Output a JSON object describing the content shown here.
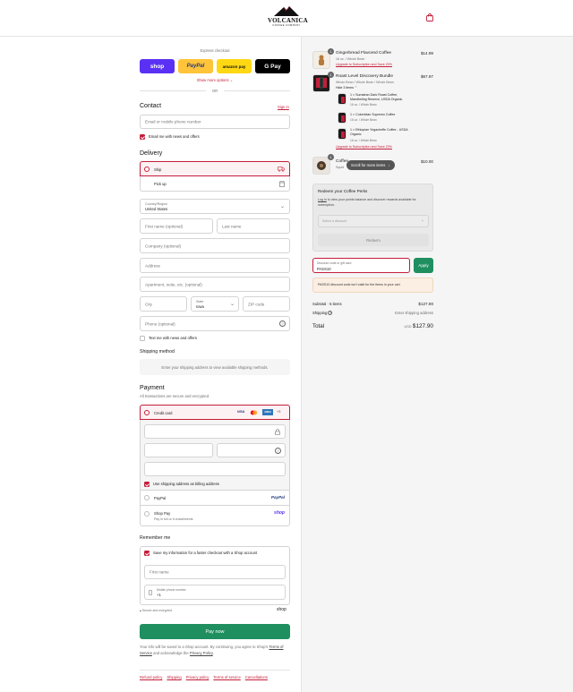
{
  "brand": {
    "name": "VOLCANICA",
    "tagline": "COFFEE COMPANY"
  },
  "express": {
    "title": "Express checkout",
    "buttons": {
      "shop": "shop",
      "paypal": "PayPal",
      "amazon": "amazon pay",
      "gpay": "G Pay"
    },
    "show_more": "Show more options",
    "or": "OR"
  },
  "contact": {
    "title": "Contact",
    "sign_in": "Sign in",
    "email_placeholder": "Email or mobile phone number",
    "news_label": "Email me with news and offers"
  },
  "delivery": {
    "title": "Delivery",
    "options": [
      {
        "label": "Ship"
      },
      {
        "label": "Pick up"
      }
    ],
    "country_label": "Country/Region",
    "country_value": "United States",
    "first_name": "First name (optional)",
    "last_name": "Last name",
    "company": "Company (optional)",
    "address": "Address",
    "apartment": "Apartment, suite, etc. (optional)",
    "city": "City",
    "state_label": "State",
    "state_value": "Iowa",
    "zip": "ZIP code",
    "phone": "Phone (optional)",
    "text_news": "Text me with news and offers"
  },
  "shipping_method": {
    "title": "Shipping method",
    "note": "Enter your shipping address to view available shipping methods."
  },
  "payment": {
    "title": "Payment",
    "subtitle": "All transactions are secure and encrypted.",
    "credit_card": "Credit card",
    "card_logos": [
      "VISA",
      "MC",
      "AMEX",
      "+3"
    ],
    "use_shipping": "Use shipping address as billing address",
    "paypal": "PayPal",
    "paypal_logo": "PayPal",
    "shop_pay": "Shop Pay",
    "shop_pay_sub": "Pay in full or in installments",
    "shop_logo": "shop"
  },
  "remember": {
    "title": "Remember me",
    "save_label": "Save my information for a faster checkout with a Shop account",
    "first_name": "First name",
    "mobile_label": "Mobile phone number",
    "mobile_value": "+1",
    "secure": "Secure and encrypted",
    "shop_logo": "shop"
  },
  "pay_now": "Pay now",
  "legal": {
    "text1": "Your info will be saved to a Shop account. By continuing, you agree to Shop's",
    "terms": "Terms of Service",
    "and": "and acknowledge the",
    "privacy": "Privacy Policy",
    "period": "."
  },
  "footer_links": [
    "Refund policy",
    "Shipping",
    "Privacy policy",
    "Terms of service",
    "Cancellations"
  ],
  "cart": {
    "items": [
      {
        "qty": "1",
        "name": "Gingerbread Flavored Coffee",
        "variant": "16 oz. / Whole Bean",
        "upsell": "Upgrade to Subscription and Save 20%",
        "price": "$14.99"
      },
      {
        "qty": "1",
        "name": "Roast Level Discovery Bundle",
        "variant": "Whole Bean / Whole Bean / Whole Bean",
        "hide": "Hide 3 items",
        "price": "$67.97",
        "sub": [
          {
            "line1": "1 × Sumatran Dark Roast Coffee,",
            "line2": "Mandheling Reserve, USDA Organic",
            "variant": "16 oz. / Whole Bean"
          },
          {
            "line1": "1 × Colombian Supremo Coffee",
            "line2": "",
            "variant": "16 oz. / Whole Bean"
          },
          {
            "line1": "1 × Ethiopian Yirgacheffe Coffee - USDA",
            "line2": "Organic",
            "variant": "16 oz. / Whole Bean"
          }
        ],
        "upsell": "Upgrade to Subscription and Save 20%"
      },
      {
        "qty": "1",
        "name": "Coffee",
        "variant": "Squid",
        "price": "$10.00"
      }
    ],
    "scroll_hint": "Scroll for more items",
    "perks": {
      "title": "Redeem your Coffee Perks",
      "text_link": "Log in",
      "text": "to view your points balance and discover rewards available for redemption.",
      "select": "Select a discount",
      "redeem": "Redeem"
    },
    "discount": {
      "label": "Discount code or gift card",
      "value": "PASS10",
      "apply": "Apply",
      "error": "PASS10 discount code isn't valid for the items in your cart"
    },
    "subtotal_label": "Subtotal · 5 items",
    "subtotal": "$127.90",
    "shipping_label": "Shipping",
    "shipping_value": "Enter shipping address",
    "total_label": "Total",
    "currency": "USD",
    "total": "$127.90"
  },
  "colors": {
    "accent": "#c41e3a",
    "pay": "#1f8f5f",
    "shop": "#5a31f4",
    "paypal": "#ffc439",
    "amazon": "#ffd814"
  }
}
